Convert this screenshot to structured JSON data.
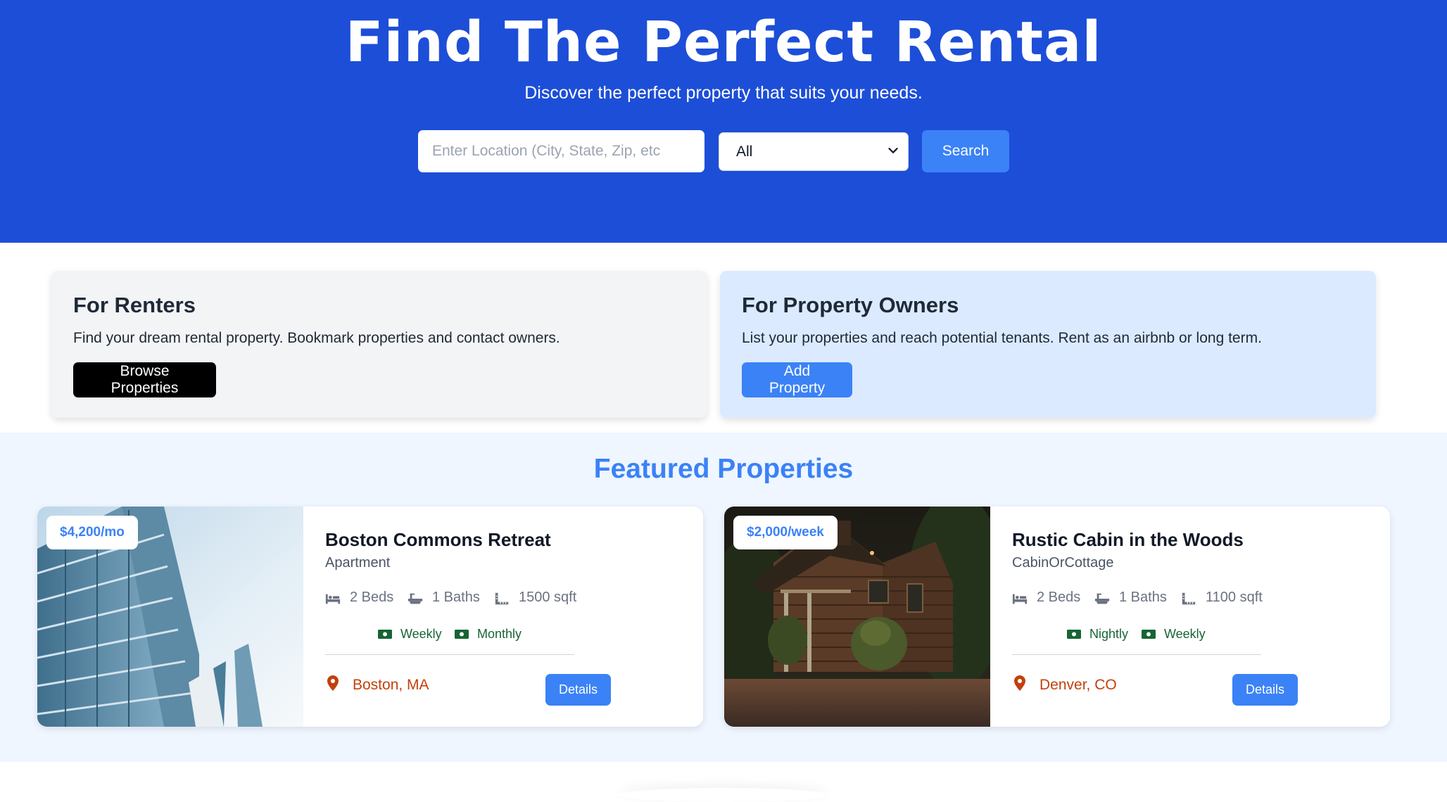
{
  "hero": {
    "title": "Find The Perfect Rental",
    "subtitle": "Discover the perfect property that suits your needs.",
    "search_placeholder": "Enter Location (City, State, Zip, etc",
    "type_select_value": "All",
    "search_label": "Search",
    "background": "#1d4ed8"
  },
  "info_cards": {
    "renters": {
      "title": "For Renters",
      "text": "Find your dream rental property. Bookmark properties and contact owners.",
      "button": "Browse Properties"
    },
    "owners": {
      "title": "For Property Owners",
      "text": "List your properties and reach potential tenants. Rent as an airbnb or long term.",
      "button": "Add Property"
    }
  },
  "featured": {
    "title": "Featured Properties",
    "properties": [
      {
        "price": "$4,200/mo",
        "name": "Boston Commons Retreat",
        "type": "Apartment",
        "beds": "2 Beds",
        "baths": "1 Baths",
        "sqft": "1500 sqft",
        "rates": [
          "Weekly",
          "Monthly"
        ],
        "location": "Boston, MA",
        "details_label": "Details"
      },
      {
        "price": "$2,000/week",
        "name": "Rustic Cabin in the Woods",
        "type": "CabinOrCottage",
        "beds": "2 Beds",
        "baths": "1 Baths",
        "sqft": "1100 sqft",
        "rates": [
          "Nightly",
          "Weekly"
        ],
        "location": "Denver, CO",
        "details_label": "Details"
      }
    ]
  },
  "colors": {
    "accent": "#3b82f6",
    "location": "#c2410c",
    "rate": "#166534"
  }
}
